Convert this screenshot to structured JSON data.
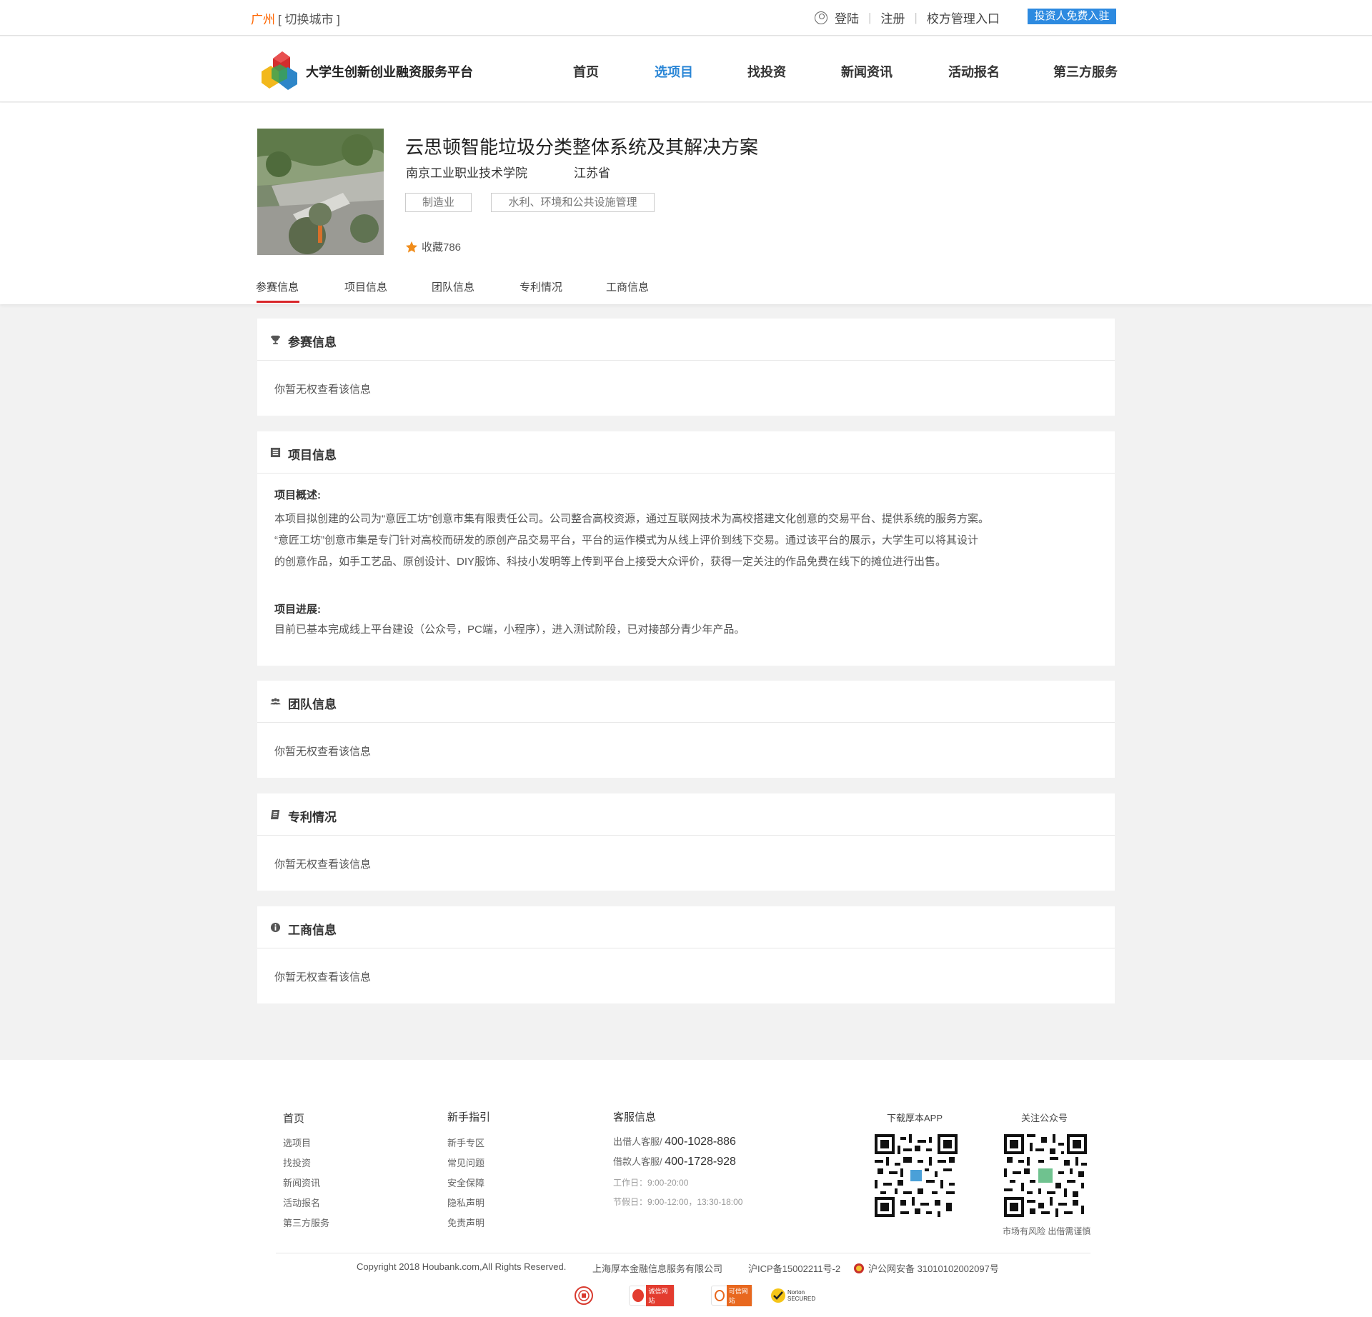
{
  "topbar": {
    "city": "广州",
    "switch_city": "[ 切换城市 ]",
    "login": "登陆",
    "register": "注册",
    "school_entry": "校方管理入口",
    "invest_button": "投资人免费入驻"
  },
  "header": {
    "brand": "大学生创新创业融资服务平台",
    "nav": [
      "首页",
      "选项目",
      "找投资",
      "新闻资讯",
      "活动报名",
      "第三方服务"
    ],
    "active_nav": "选项目"
  },
  "project": {
    "title": "云思顿智能垃圾分类整体系统及其解决方案",
    "school": "南京工业职业技术学院",
    "province": "江苏省",
    "tags": [
      "制造业",
      "水利、环境和公共设施管理"
    ],
    "favorites": "收藏786",
    "tabs": [
      "参赛信息",
      "项目信息",
      "团队信息",
      "专利情况",
      "工商信息"
    ]
  },
  "sections": {
    "competition": {
      "title": "参赛信息",
      "text": "你暂无权查看该信息"
    },
    "project_info": {
      "title": "项目信息",
      "overview_label": "项目概述:",
      "overview_lines": [
        "本项目拟创建的公司为“意匠工坊”创意市集有限责任公司。公司整合高校资源，通过互联网技术为高校搭建文化创意的交易平台、提供系统的服务方案。",
        "“意匠工坊”创意市集是专门针对高校而研发的原创产品交易平台，平台的运作模式为从线上评价到线下交易。通过该平台的展示，大学生可以将其设计",
        "的创意作品，如手工艺品、原创设计、DIY服饰、科技小发明等上传到平台上接受大众评价，获得一定关注的作品免费在线下的摊位进行出售。"
      ],
      "progress_label": "项目进展:",
      "progress_text": "目前已基本完成线上平台建设（公众号，PC端，小程序），进入测试阶段，已对接部分青少年产品。"
    },
    "team": {
      "title": "团队信息",
      "text": "你暂无权查看该信息"
    },
    "patent": {
      "title": "专利情况",
      "text": "你暂无权查看该信息"
    },
    "business": {
      "title": "工商信息",
      "text": "你暂无权查看该信息"
    }
  },
  "footer": {
    "col1": {
      "title": "首页",
      "links": [
        "选项目",
        "找投资",
        "新闻资讯",
        "活动报名",
        "第三方服务"
      ]
    },
    "col2": {
      "title": "新手指引",
      "links": [
        "新手专区",
        "常见问题",
        "安全保障",
        "隐私声明",
        "免责声明"
      ]
    },
    "service": {
      "title": "客服信息",
      "lender_label": "出借人客服/",
      "lender_phone": "400-1028-886",
      "borrower_label": "借款人客服/",
      "borrower_phone": "400-1728-928",
      "workday": "工作日：9:00-20:00",
      "holiday": "节假日：9:00-12:00，13:30-18:00"
    },
    "app_title": "下载厚本APP",
    "wechat_title": "关注公众号",
    "risk": "市场有风险 出借需谨慎",
    "copyright": "Copyright 2018 Houbank.com,All Rights Reserved.",
    "company": "上海厚本金融信息服务有限公司",
    "icp": "沪ICP备15002211号-2",
    "police": "沪公网安备 31010102002097号",
    "badges": [
      "诚信网站",
      "可信网站",
      "Norton SECURED"
    ]
  },
  "colors": {
    "accent_blue": "#2a86d6",
    "city_orange": "#ff6600",
    "tab_red": "#d9272b",
    "invest_blue": "#2d8ae0"
  }
}
